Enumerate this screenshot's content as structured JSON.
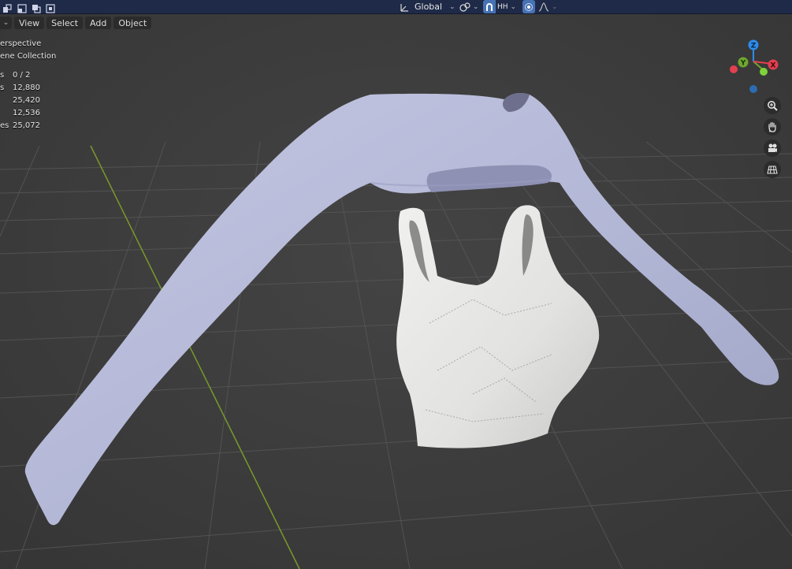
{
  "header": {
    "transform_orientation": "Global",
    "snap_label": "HH",
    "menus": [
      "View",
      "Select",
      "Add",
      "Object"
    ]
  },
  "overlay": {
    "view_name": "erspective",
    "collection": "ene Collection",
    "stats": [
      {
        "label": "s",
        "value": "0 / 2"
      },
      {
        "label": "s",
        "value": "12,880"
      },
      {
        "label": "",
        "value": "25,420"
      },
      {
        "label": "",
        "value": "12,536"
      },
      {
        "label": "es",
        "value": "25,072"
      }
    ]
  },
  "gizmo": {
    "axes": [
      {
        "label": "Z",
        "color": "#2d8ceb"
      },
      {
        "label": "Y",
        "color": "#6fa630"
      },
      {
        "label": "X",
        "color": "#e2404f"
      }
    ]
  },
  "nav_icons": [
    "zoom-icon",
    "hand-pan-icon",
    "camera-icon",
    "grid-ortho-icon"
  ],
  "colors": {
    "header_bg": "#1f2a48",
    "viewport_bg": "#3d3d3d",
    "grid_line": "#555555",
    "y_axis_line": "#7a9a2a",
    "sweater": "#b4b8d6",
    "top": "#e4e4e2"
  }
}
